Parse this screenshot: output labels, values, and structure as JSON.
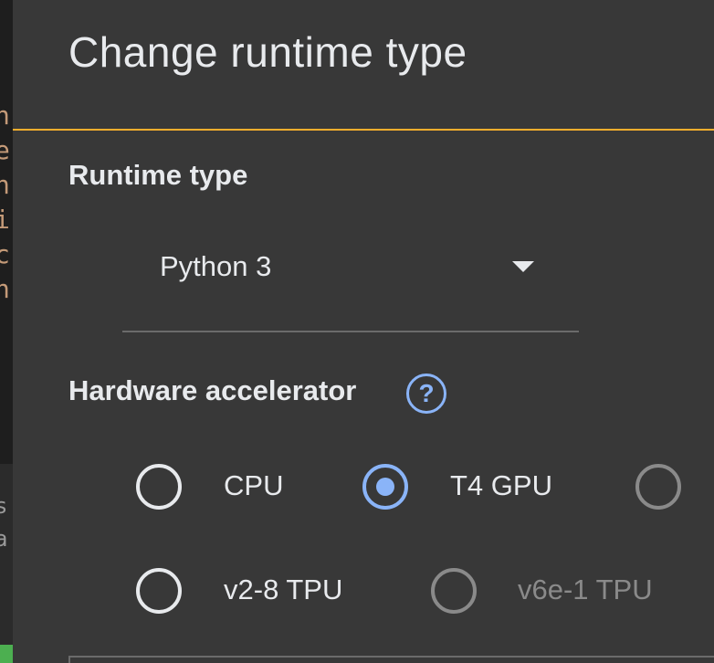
{
  "background": {
    "code_chars": [
      "n",
      "e",
      "n",
      "i",
      "c",
      "n"
    ],
    "panel_chars": [
      "s",
      "a"
    ]
  },
  "dialog": {
    "title": "Change runtime type",
    "runtime_type": {
      "label": "Runtime type",
      "selected_value": "Python 3"
    },
    "hardware_accelerator": {
      "label": "Hardware accelerator",
      "help_glyph": "?",
      "options": [
        {
          "label": "CPU",
          "selected": false,
          "enabled": true
        },
        {
          "label": "T4 GPU",
          "selected": true,
          "enabled": true
        },
        {
          "label": "",
          "selected": false,
          "enabled": false
        },
        {
          "label": "v2-8 TPU",
          "selected": false,
          "enabled": true
        },
        {
          "label": "v6e-1 TPU",
          "selected": false,
          "enabled": false
        }
      ]
    }
  },
  "colors": {
    "dialog_bg": "#383838",
    "accent_divider": "#f6ae2d",
    "selected_radio": "#8ab4f8",
    "text": "#e8eaed",
    "disabled": "#8a8a8a"
  }
}
